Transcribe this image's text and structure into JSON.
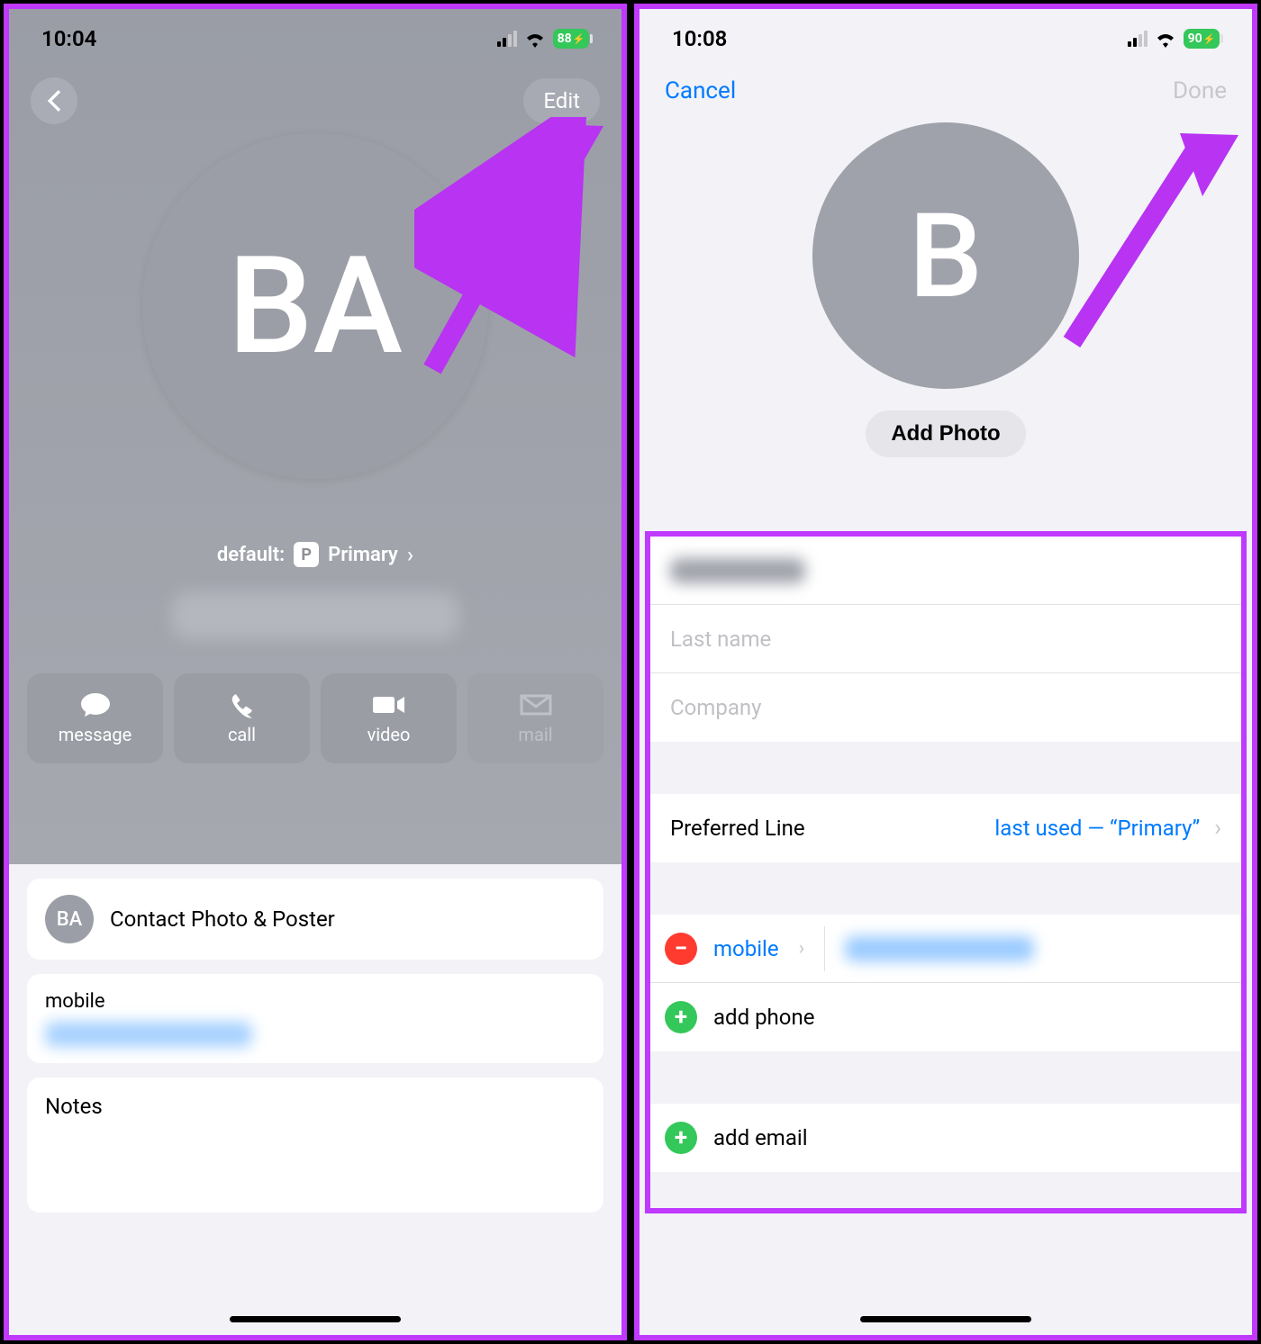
{
  "left": {
    "status": {
      "time": "10:04",
      "battery": "88"
    },
    "nav": {
      "edit": "Edit"
    },
    "avatar_initials": "BA",
    "default_label": "default:",
    "default_badge": "P",
    "default_value": "Primary",
    "actions": {
      "message": "message",
      "call": "call",
      "video": "video",
      "mail": "mail"
    },
    "cards": {
      "photo_poster_initials": "BA",
      "photo_poster": "Contact Photo & Poster",
      "mobile_label": "mobile",
      "notes": "Notes"
    }
  },
  "right": {
    "status": {
      "time": "10:08",
      "battery": "90"
    },
    "nav": {
      "cancel": "Cancel",
      "done": "Done"
    },
    "avatar_initials": "B",
    "add_photo": "Add Photo",
    "fields": {
      "last_name_ph": "Last name",
      "company_ph": "Company"
    },
    "preferred_line": {
      "label": "Preferred Line",
      "value": "last used — “Primary”"
    },
    "phone": {
      "type_label": "mobile",
      "add_phone": "add phone",
      "add_email": "add email"
    }
  }
}
